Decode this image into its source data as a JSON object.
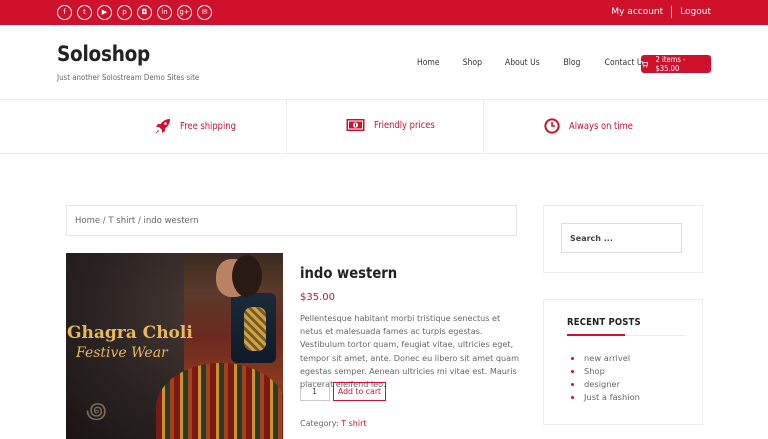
{
  "topbar": {
    "social_icons": [
      {
        "name": "facebook-icon",
        "glyph": "f"
      },
      {
        "name": "twitter-icon",
        "glyph": "t"
      },
      {
        "name": "youtube-icon",
        "glyph": "▶"
      },
      {
        "name": "pinterest-icon",
        "glyph": "p"
      },
      {
        "name": "instagram-icon",
        "glyph": "◘"
      },
      {
        "name": "linkedin-icon",
        "glyph": "in"
      },
      {
        "name": "googleplus-icon",
        "glyph": "g+"
      },
      {
        "name": "email-icon",
        "glyph": "✉"
      }
    ],
    "my_account": "My account",
    "logout": "Logout"
  },
  "header": {
    "site_title": "Soloshop",
    "tagline": "Just another Solostream Demo Sites site",
    "nav": [
      "Home",
      "Shop",
      "About Us",
      "Blog",
      "Contact Us"
    ],
    "cart_label": "2 items - $35.00"
  },
  "features": [
    {
      "icon": "rocket-icon",
      "label": "Free shipping"
    },
    {
      "icon": "money-icon",
      "label": "Friendly prices"
    },
    {
      "icon": "clock-icon",
      "label": "Always on time"
    }
  ],
  "breadcrumb": "Home / T shirt / indo western",
  "product": {
    "image_text_line1": "Ghagra Choli",
    "image_text_line2": "Festive Wear",
    "title": "indo western",
    "price": "$35.00",
    "description": "Pellentesque habitant morbi tristique senectus et netus et malesuada fames ac turpis egestas. Vestibulum tortor quam, feugiat vitae, ultricies eget, tempor sit amet, ante. Donec eu libero sit amet quam egestas semper. Aenean ultricies mi vitae est. Mauris placerat eleifend leo.",
    "quantity": "1",
    "add_to_cart": "Add to cart",
    "category_label": "Category:",
    "category_value": "T shirt"
  },
  "sidebar": {
    "search_placeholder": "Search ...",
    "recent_posts_title": "RECENT POSTS",
    "recent_posts": [
      "new arrivel",
      "Shop",
      "designer",
      "Just a fashion"
    ]
  },
  "colors": {
    "accent": "#d0112b",
    "text": "#555555",
    "border": "#ececec"
  }
}
